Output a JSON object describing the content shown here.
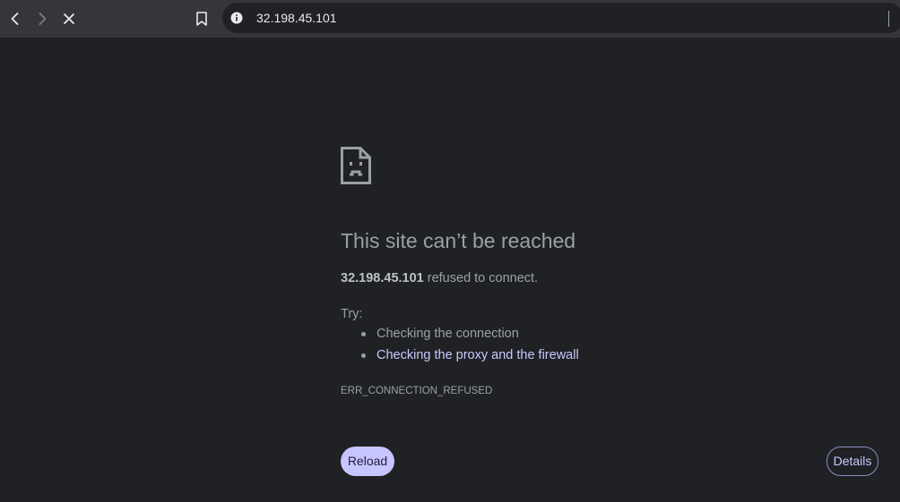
{
  "toolbar": {
    "url": "32.198.45.101",
    "icons": {
      "back": "chevron-left-icon",
      "forward": "chevron-right-icon",
      "stop": "close-icon",
      "bookmark": "bookmark-icon",
      "info": "info-icon"
    }
  },
  "error_page": {
    "icon": "sad-page-icon",
    "headline": "This site can’t be reached",
    "host": "32.198.45.101",
    "message": " refused to connect.",
    "try_label": "Try:",
    "suggestions": [
      {
        "label": "Checking the connection",
        "is_link": false
      },
      {
        "label": "Checking the proxy and the firewall",
        "is_link": true
      }
    ],
    "error_code": "ERR_CONNECTION_REFUSED",
    "reload_label": "Reload",
    "details_label": "Details"
  },
  "colors": {
    "background": "#202124",
    "toolbar": "#35363a",
    "text_muted": "#9aa0a6",
    "link": "#c9c8ff",
    "button_fill": "#c7c5ff"
  }
}
